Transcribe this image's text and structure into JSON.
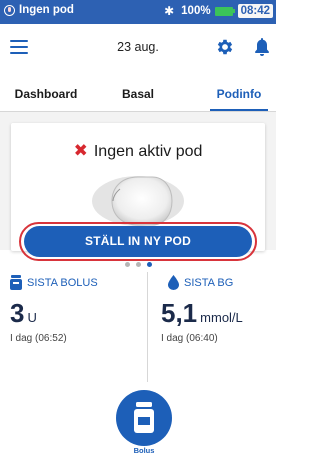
{
  "status_bar": {
    "title": "Ingen pod",
    "battery": "100%",
    "time": "08:42"
  },
  "toolbar": {
    "date": "23 aug."
  },
  "tabs": [
    {
      "label": "Dashboard",
      "active": false
    },
    {
      "label": "Basal",
      "active": false
    },
    {
      "label": "Podinfo",
      "active": true
    }
  ],
  "pod_card": {
    "message": "Ingen aktiv pod",
    "button_label": "STÄLL IN NY POD"
  },
  "pager": {
    "count": 3,
    "active_index": 2
  },
  "last_bolus": {
    "label": "SISTA BOLUS",
    "value": "3",
    "unit": "U",
    "time": "I dag (06:52)"
  },
  "last_bg": {
    "label": "SISTA BG",
    "value": "5,1",
    "unit": "mmol/L",
    "time": "I dag (06:40)"
  },
  "bolus_button": {
    "label": "Bolus"
  },
  "colors": {
    "primary": "#1d5fb8",
    "status_bar": "#2d61b3",
    "alert": "#d7282f",
    "highlight": "#d8343b",
    "battery": "#3bc35a"
  }
}
